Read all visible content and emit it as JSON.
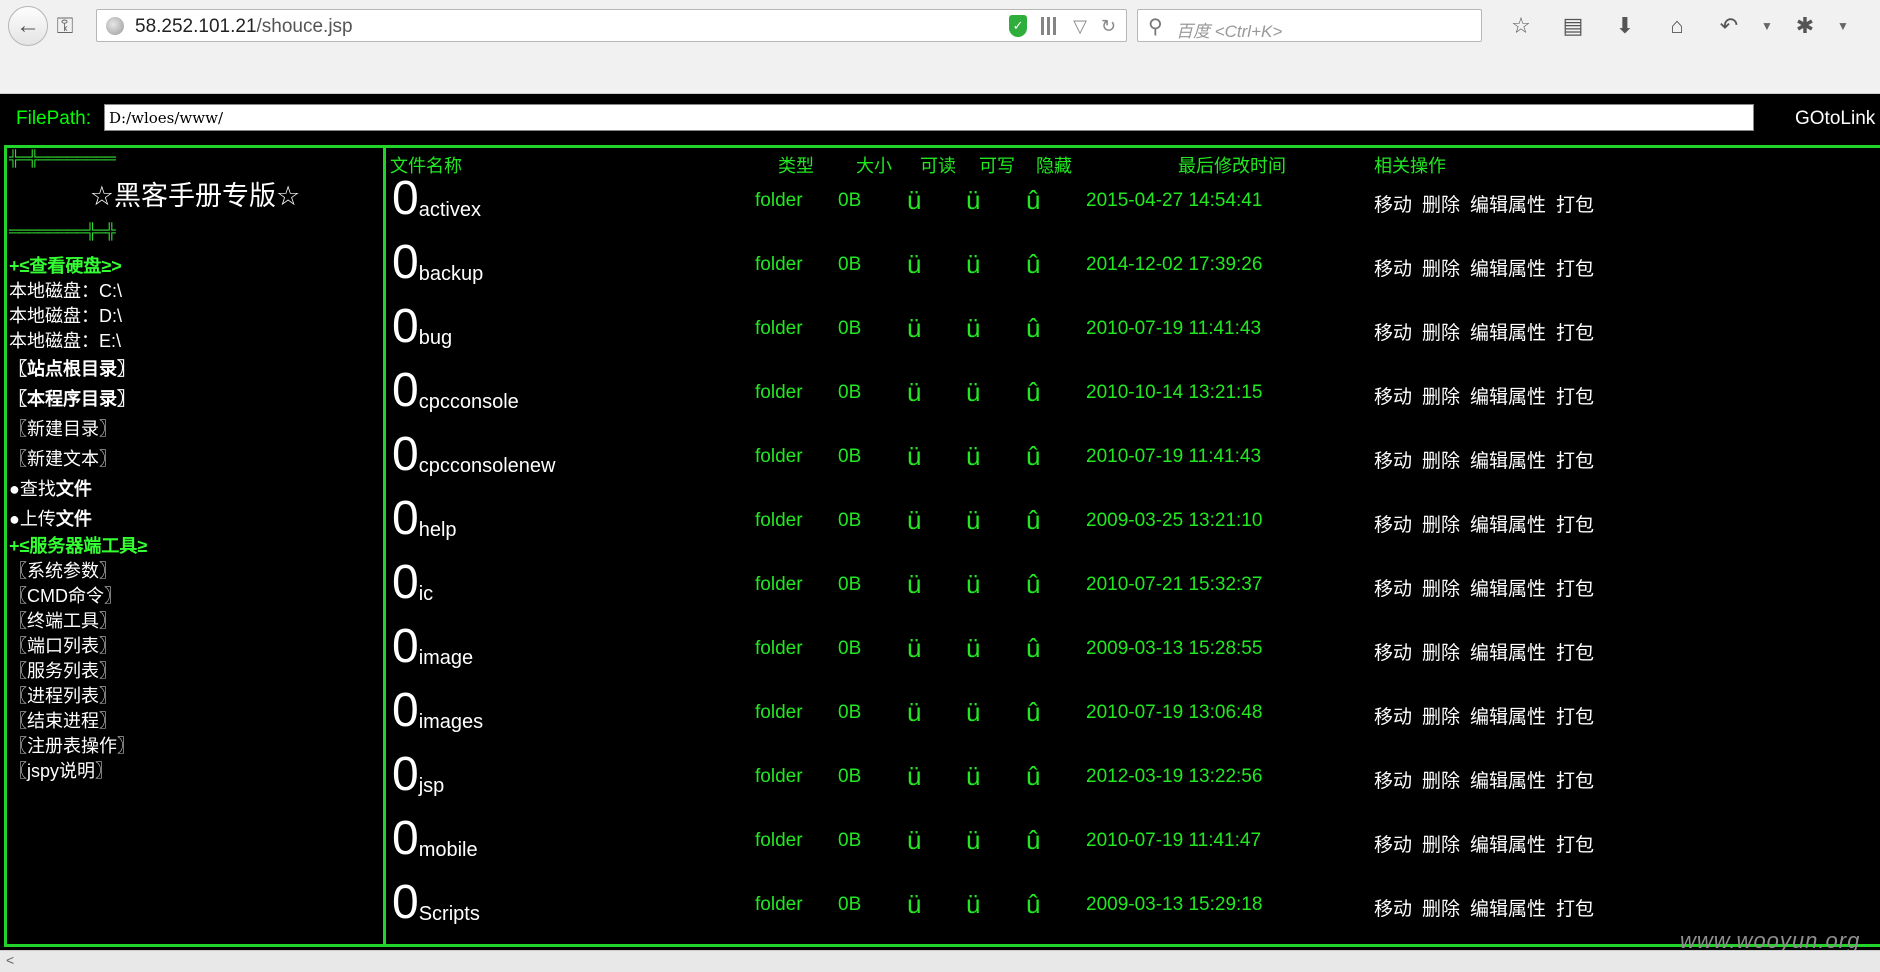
{
  "browser": {
    "url_host": "58.252.101.21",
    "url_path": "/shouce.jsp",
    "search_placeholder": "百度 <Ctrl+K>"
  },
  "pathbar": {
    "label": "FilePath:",
    "value": "D:/wloes/www/",
    "goto_label": "GOtoLink"
  },
  "sidebar": {
    "deco_top": "╬═╬════════",
    "title": "☆黑客手册专版☆",
    "deco_bottom": "════════╬═╬",
    "disk_header": "+≤查看硬盘≥>",
    "disks": [
      "本地磁盘：C:\\",
      "本地磁盘：D:\\",
      "本地磁盘：E:\\"
    ],
    "site_root": "〖站点根目录〗",
    "program_dir": "〖本程序目录〗",
    "new_dir": "〖新建目录〗",
    "new_text": "〖新建文本〗",
    "search_prefix": "●查找",
    "search_suffix": "文件",
    "upload_prefix": "●上传",
    "upload_suffix": "文件",
    "server_header": "+≤服务器端工具≥",
    "tools": [
      "〖系统参数〗",
      "〖CMD命令〗",
      "〖终端工具〗",
      "〖端口列表〗",
      "〖服务列表〗",
      "〖进程列表〗",
      "〖结束进程〗",
      "〖注册表操作〗",
      "〖jspy说明〗"
    ]
  },
  "table": {
    "headers": {
      "name": "文件名称",
      "type": "类型",
      "size": "大小",
      "read": "可读",
      "write": "可写",
      "hidden": "隐藏",
      "mtime": "最后修改时间",
      "ops": "相关操作"
    },
    "ops": {
      "move": "移动",
      "delete": "删除",
      "edit": "编辑属性",
      "pack": "打包"
    },
    "rows": [
      {
        "icon": "0",
        "name": "activex",
        "type": "folder",
        "size": "0B",
        "read": "ü",
        "write": "ü",
        "hidden": "û",
        "mtime": "2015-04-27 14:54:41"
      },
      {
        "icon": "0",
        "name": "backup",
        "type": "folder",
        "size": "0B",
        "read": "ü",
        "write": "ü",
        "hidden": "û",
        "mtime": "2014-12-02 17:39:26"
      },
      {
        "icon": "0",
        "name": "bug",
        "type": "folder",
        "size": "0B",
        "read": "ü",
        "write": "ü",
        "hidden": "û",
        "mtime": "2010-07-19 11:41:43"
      },
      {
        "icon": "0",
        "name": "cpcconsole",
        "type": "folder",
        "size": "0B",
        "read": "ü",
        "write": "ü",
        "hidden": "û",
        "mtime": "2010-10-14 13:21:15"
      },
      {
        "icon": "0",
        "name": "cpcconsolenew",
        "type": "folder",
        "size": "0B",
        "read": "ü",
        "write": "ü",
        "hidden": "û",
        "mtime": "2010-07-19 11:41:43"
      },
      {
        "icon": "0",
        "name": "help",
        "type": "folder",
        "size": "0B",
        "read": "ü",
        "write": "ü",
        "hidden": "û",
        "mtime": "2009-03-25 13:21:10"
      },
      {
        "icon": "0",
        "name": "ic",
        "type": "folder",
        "size": "0B",
        "read": "ü",
        "write": "ü",
        "hidden": "û",
        "mtime": "2010-07-21 15:32:37"
      },
      {
        "icon": "0",
        "name": "image",
        "type": "folder",
        "size": "0B",
        "read": "ü",
        "write": "ü",
        "hidden": "û",
        "mtime": "2009-03-13 15:28:55"
      },
      {
        "icon": "0",
        "name": "images",
        "type": "folder",
        "size": "0B",
        "read": "ü",
        "write": "ü",
        "hidden": "û",
        "mtime": "2010-07-19 13:06:48"
      },
      {
        "icon": "0",
        "name": "jsp",
        "type": "folder",
        "size": "0B",
        "read": "ü",
        "write": "ü",
        "hidden": "û",
        "mtime": "2012-03-19 13:22:56"
      },
      {
        "icon": "0",
        "name": "mobile",
        "type": "folder",
        "size": "0B",
        "read": "ü",
        "write": "ü",
        "hidden": "û",
        "mtime": "2010-07-19 11:41:47"
      },
      {
        "icon": "0",
        "name": "Scripts",
        "type": "folder",
        "size": "0B",
        "read": "ü",
        "write": "ü",
        "hidden": "û",
        "mtime": "2009-03-13 15:29:18"
      }
    ]
  },
  "watermark": "www.wooyun.org",
  "colors": {
    "accent_green": "#22e822",
    "border_green": "#22d32a",
    "background": "#000000"
  }
}
